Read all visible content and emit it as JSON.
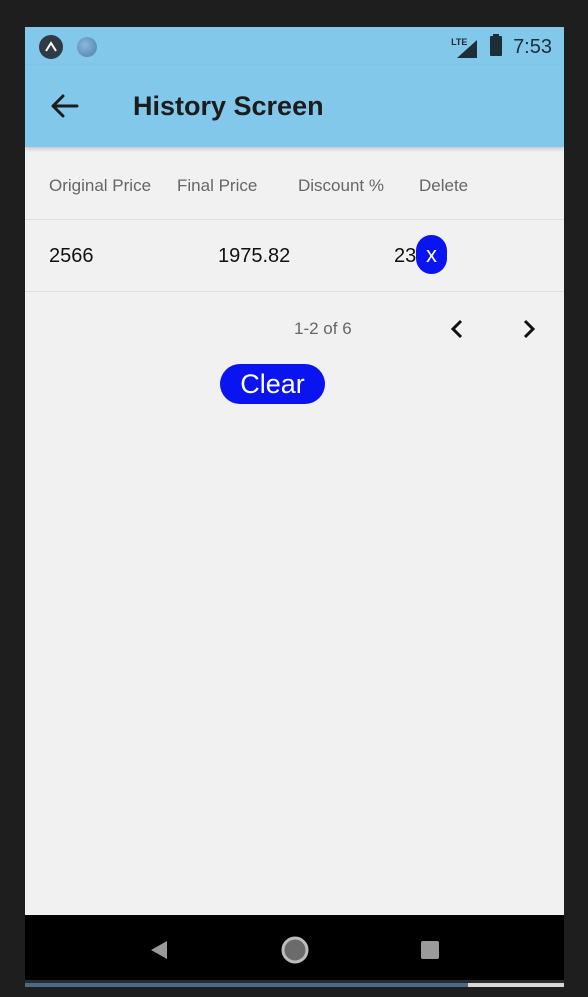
{
  "status_bar": {
    "time": "7:53",
    "network": "LTE",
    "icons": [
      "app-notification-icon",
      "circle-notification-icon",
      "lte-signal-icon",
      "battery-icon"
    ]
  },
  "app_bar": {
    "title": "History Screen",
    "back_icon": "arrow-left-icon",
    "background": "#82c8ea"
  },
  "table": {
    "headers": [
      "Original Price",
      "Final Price",
      "Discount %",
      "Delete"
    ],
    "rows": [
      {
        "original_price": "2566",
        "final_price": "1975.82",
        "discount": "23",
        "delete_label": "x"
      }
    ]
  },
  "pagination": {
    "label": "1-2 of 6",
    "prev_icon": "chevron-left-icon",
    "next_icon": "chevron-right-icon"
  },
  "clear_button": {
    "label": "Clear",
    "color": "#0a14f0"
  },
  "nav_bar": {
    "icons": [
      "back-triangle-icon",
      "home-circle-icon",
      "recents-square-icon"
    ]
  }
}
